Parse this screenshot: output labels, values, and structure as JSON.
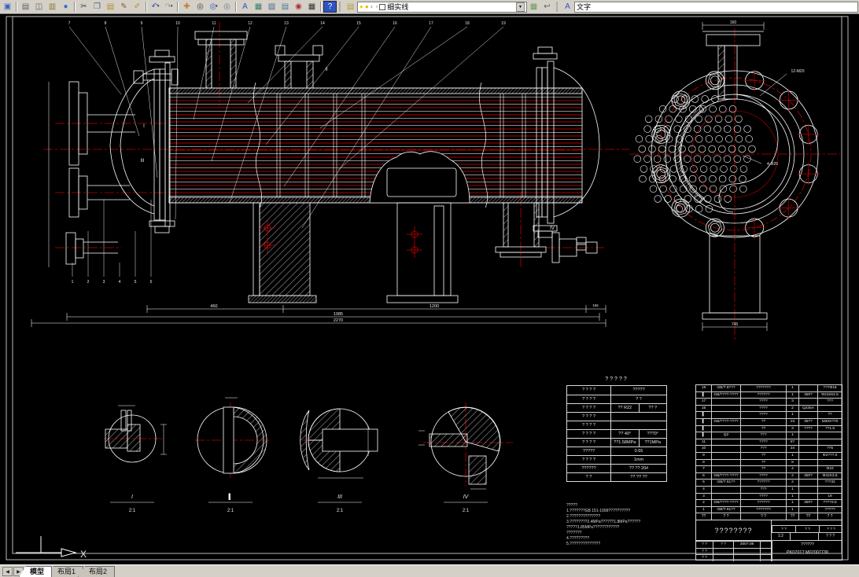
{
  "toolbar": {
    "groups": {
      "standard": [
        {
          "name": "save",
          "glyph": "▣",
          "color": "#3a62c4"
        },
        {
          "sep": true
        },
        {
          "name": "print",
          "glyph": "▤",
          "color": "#5a5f66"
        },
        {
          "name": "print-preview",
          "glyph": "◫",
          "color": "#5a5f66"
        },
        {
          "name": "publish",
          "glyph": "▥",
          "color": "#8a7a30"
        },
        {
          "name": "web",
          "glyph": "●",
          "color": "#2f74c0"
        },
        {
          "sep": true
        },
        {
          "name": "cut",
          "glyph": "✂",
          "color": "#444444"
        },
        {
          "name": "copy",
          "glyph": "❐",
          "color": "#50607a"
        },
        {
          "name": "paste",
          "glyph": "▤",
          "color": "#b08f2a"
        },
        {
          "name": "match-properties",
          "glyph": "✎",
          "color": "#8a5a2a"
        },
        {
          "name": "block-editor",
          "glyph": "✐",
          "color": "#b0a02a"
        },
        {
          "sep": true
        },
        {
          "name": "undo",
          "glyph": "↶",
          "color": "#2f54c0",
          "flyout": true
        },
        {
          "name": "redo",
          "glyph": "↷",
          "color": "#9aa0a8",
          "flyout": true
        },
        {
          "sep": true
        },
        {
          "name": "pan",
          "glyph": "✚",
          "color": "#c07f2a"
        },
        {
          "name": "zoom-realtime",
          "glyph": "◎",
          "color": "#3a3f46"
        },
        {
          "name": "zoom-window",
          "glyph": "◎",
          "color": "#3a62c4",
          "flyout": true
        },
        {
          "name": "zoom-previous",
          "glyph": "◎",
          "color": "#6a7f96"
        },
        {
          "sep": true
        },
        {
          "name": "find",
          "glyph": "A",
          "color": "#2f54c0"
        },
        {
          "name": "designcenter",
          "glyph": "▦",
          "color": "#3d7a6a"
        },
        {
          "name": "properties",
          "glyph": "▨",
          "color": "#4a6a9a"
        },
        {
          "name": "tool-palettes",
          "glyph": "▤",
          "color": "#4a7a9a"
        },
        {
          "name": "markup",
          "glyph": "◉",
          "color": "#b03030"
        },
        {
          "name": "quickcalc",
          "glyph": "▦",
          "color": "#333333"
        },
        {
          "sep": true
        },
        {
          "name": "help",
          "glyph": "?",
          "color": "#ffffff",
          "bg": "#2f54c0"
        }
      ],
      "layers_left": [
        {
          "name": "layer-properties",
          "glyph": "▤",
          "color": "#b0a02a"
        }
      ],
      "layers_right": [
        {
          "name": "make-object-layer-current",
          "glyph": "▦",
          "color": "#6a9a5a"
        },
        {
          "name": "layer-previous",
          "glyph": "↩",
          "color": "#50607a"
        }
      ],
      "styles": [
        {
          "name": "text-style",
          "glyph": "A",
          "color": "#2f54c0"
        }
      ]
    },
    "layer_combo": {
      "value": "细实线",
      "state_icons": [
        {
          "name": "bulb-icon",
          "glyph": "●",
          "color": "#f5d000"
        },
        {
          "name": "freeze-icon",
          "glyph": "●",
          "color": "#f0b400"
        },
        {
          "name": "lock-icon",
          "glyph": "◐",
          "color": "#b9b48e"
        },
        {
          "name": "plot-icon",
          "glyph": "▫",
          "color": "#777777"
        }
      ],
      "dropdown_arrow": "▼"
    },
    "style_combo": {
      "value": "文字"
    }
  },
  "drawing": {
    "main_view": {
      "balloons_top": [
        "7",
        "8",
        "9",
        "10",
        "11",
        "12",
        "13",
        "14",
        "15",
        "16",
        "17",
        "18",
        "19"
      ],
      "balloons_left": [
        "1",
        "2",
        "3",
        "4",
        "5",
        "6"
      ],
      "markers": [
        "I",
        "III",
        "II",
        "IV"
      ],
      "dims": {
        "d460": "460",
        "d1200": "1200",
        "d1985": "1985",
        "d2270": "2270",
        "d155": "155"
      }
    },
    "end_view": {
      "label_bolts": "12-M20",
      "label_holes": "4-Φ25",
      "dim_top": "160",
      "dim_bottom": "745"
    },
    "detail_views": [
      {
        "label": "I",
        "scale": "2:1"
      },
      {
        "label": "▌",
        "scale": "2:1"
      },
      {
        "label": "III",
        "scale": "2:1"
      },
      {
        "label": "IV",
        "scale": "2:1"
      }
    ],
    "ucs_label": "X"
  },
  "spec_table": {
    "title": "?????",
    "rows": [
      {
        "l": "? ? ? ?",
        "r": "?????"
      },
      {
        "l": "? ? ? ?",
        "r": "? ?"
      },
      {
        "l": "? ? ? ?",
        "r1": "?? R22",
        "r2": "?? ?"
      },
      {
        "l": "? ? ? ?",
        "r": ""
      },
      {
        "l": "? ? ? ?",
        "r": ""
      },
      {
        "l": "? ? ? ?",
        "r1": "?? 40°",
        "r2": "???0°"
      },
      {
        "l": "? ? ? ?",
        "r1": "??1.58MPa",
        "r2": "??1MPa"
      },
      {
        "l": "?????",
        "r": "0.65"
      },
      {
        "l": "? ? ? ?",
        "r": "1mm"
      },
      {
        "l": "??????",
        "r": "?? ?? 20#"
      },
      {
        "l": "? ?",
        "r": "?? ?? ??"
      }
    ]
  },
  "notes": {
    "lines": [
      "?????",
      "1.???????GB 151-1999??????????",
      "2.??????????????",
      "3.????????2.4MPa??????1.8MPa??????",
      "      ?????1.85MPa????????????",
      "      ???????",
      "4.?????????",
      "5.??????????????"
    ]
  },
  "bom": {
    "rows": [
      [
        "19",
        "GB/T 8???",
        "???????",
        "1",
        "",
        "???Φ16"
      ],
      [
        "▌",
        "GB/????-????",
        "??????",
        "1",
        "35#?",
        "Φ219Χ2.5"
      ],
      [
        "17",
        "",
        "????",
        "3",
        "",
        "???"
      ],
      [
        "16",
        "",
        "????",
        "2",
        "Q235A",
        ""
      ],
      [
        "▌",
        "",
        "????",
        "1",
        "",
        "??"
      ],
      [
        "▌",
        "GB/????-????",
        "??",
        "24",
        "35??",
        "M20Χ??0"
      ],
      [
        "▌",
        "",
        "??",
        "3",
        "????",
        "??1.5"
      ],
      [
        "▌",
        "Q2",
        "???",
        "1",
        "",
        ""
      ],
      [
        "11",
        "",
        "????",
        "8?",
        "",
        ""
      ],
      [
        "10",
        "",
        "???",
        "24",
        "",
        "??5"
      ],
      [
        "9",
        "",
        "??",
        "1",
        "",
        "Φ2???.0"
      ],
      [
        "8",
        "",
        "??",
        "8",
        "",
        ""
      ],
      [
        "7",
        "",
        "??",
        "4",
        "",
        "Φ10"
      ],
      [
        "6",
        "GB/????-????",
        "????",
        "2",
        "35#?",
        "Φ42Χ3.5"
      ],
      [
        "5",
        "GB/T 61??",
        "??????",
        "2",
        "",
        "???32"
      ],
      [
        "4",
        "",
        "???",
        "1",
        "",
        ""
      ],
      [
        "3",
        "",
        "????",
        "1",
        "",
        "19"
      ],
      [
        "2",
        "GB/????-????",
        "??????",
        "1",
        "35#?",
        "????3.5"
      ],
      [
        "1",
        "GB/T 61??",
        "???????",
        "1",
        "",
        "?????"
      ]
    ],
    "header": [
      "??",
      "? ?",
      "? ?",
      "??",
      "??",
      "? ?"
    ]
  },
  "title_block": {
    "title": "????????",
    "info_rows": [
      [
        "? ?",
        "? ?",
        "2007.08"
      ],
      [
        "? ?",
        "",
        ""
      ],
      [
        "? ?",
        "",
        ""
      ]
    ],
    "right_header": [
      "? ?",
      "? ?",
      "? ? ?"
    ],
    "scale": "1:2",
    "sheet": "? ? ?",
    "code_line1": "??????",
    "code_line2": "PK0701?  M07007730"
  },
  "tabs": {
    "nav": [
      "◀",
      "▶"
    ],
    "items": [
      {
        "label": "模型",
        "active": true
      },
      {
        "label": "布局1",
        "active": false
      },
      {
        "label": "布局2",
        "active": false
      }
    ]
  }
}
